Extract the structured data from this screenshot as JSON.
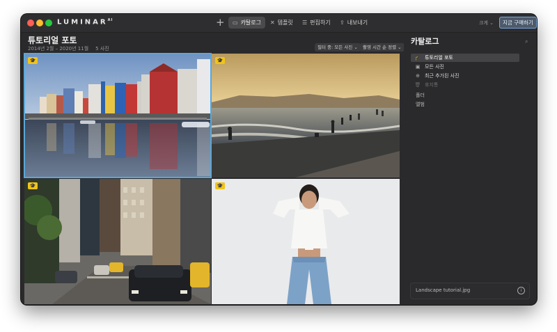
{
  "app": {
    "brand": "LUMINAR",
    "brand_suffix": "AI"
  },
  "toolbar": {
    "add_icon": "plus-icon",
    "tabs": [
      {
        "label": "카탈로그",
        "icon": "folder-icon",
        "active": true
      },
      {
        "label": "템플릿",
        "icon": "template-icon",
        "active": false
      },
      {
        "label": "편집하기",
        "icon": "sliders-icon",
        "active": false
      },
      {
        "label": "내보내기",
        "icon": "share-icon",
        "active": false
      }
    ],
    "size_label": "크게 ⌄",
    "buy_label": "지금 구매하기"
  },
  "main": {
    "title": "튜토리얼 포토",
    "date_range": "2014년 2월 – 2020년 11월",
    "count": "5 사진",
    "filter_label": "필터 중: 모든 사진 ⌄",
    "sort_label": "촬영 시간 순 정렬 ⌄",
    "photos": [
      {
        "name": "canal-houses",
        "selected": true
      },
      {
        "name": "beach-sunset",
        "selected": false
      },
      {
        "name": "city-street",
        "selected": false
      },
      {
        "name": "portrait-woman",
        "selected": false
      }
    ]
  },
  "sidebar": {
    "title": "카탈로그",
    "items": [
      {
        "label": "튜토리얼 포토",
        "icon": "graduation-cap-icon",
        "active": true
      },
      {
        "label": "모든 사진",
        "icon": "photos-icon",
        "active": false
      },
      {
        "label": "최근 추가된 사진",
        "icon": "recent-icon",
        "active": false
      },
      {
        "label": "휴지통",
        "icon": "trash-icon",
        "active": false
      }
    ],
    "groups": [
      "폴더",
      "앨범"
    ],
    "footer_filename": "Landscape tutorial.jpg"
  },
  "colors": {
    "window_bg": "#2a2a2c",
    "selection": "#5aa7d8",
    "badge": "#f0c419",
    "buy_border": "#7aa6d9"
  }
}
